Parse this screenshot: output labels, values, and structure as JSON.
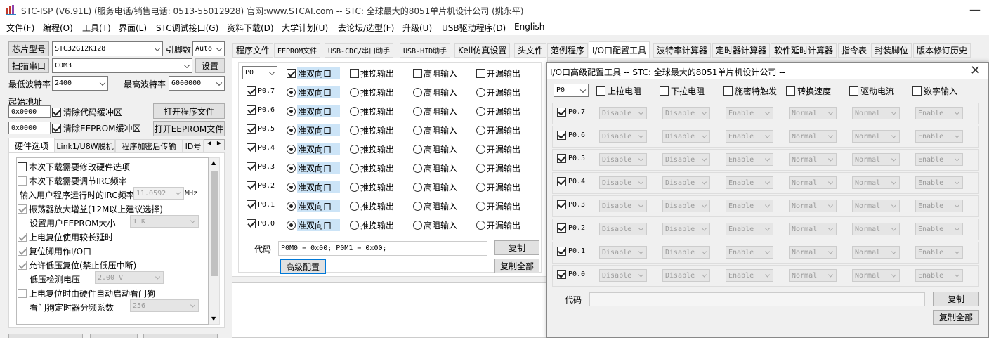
{
  "window": {
    "title": "STC-ISP (V6.91L) (服务电话/销售电话: 0513-55012928) 官网:www.STCAI.com  -- STC: 全球最大的8051单片机设计公司 (姚永平)"
  },
  "menu": [
    "文件(F)",
    "编程(O)",
    "工具(T)",
    "界面(L)",
    "STC调试接口(G)",
    "资料下载(D)",
    "大学计划(U)",
    "去论坛/选型(F)",
    "升级(U)",
    "USB驱动程序(D)",
    "English"
  ],
  "left": {
    "chip_label": "芯片型号",
    "chip_value": "STC32G12K128",
    "pins_label": "引脚数",
    "pins_value": "Auto",
    "scan_button": "扫描串口",
    "port_value": "COM3",
    "settings_button": "设置",
    "min_baud_label": "最低波特率",
    "min_baud_value": "2400",
    "max_baud_label": "最高波特率",
    "max_baud_value": "6000000",
    "start_addr_label": "起始地址",
    "addr1": "0x0000",
    "clear_code": "清除代码缓冲区",
    "open_prog": "打开程序文件",
    "addr2": "0x0000",
    "clear_eeprom": "清除EEPROM缓冲区",
    "open_eeprom": "打开EEPROM文件",
    "tabs": [
      "硬件选项",
      "Link1/U8W脱机",
      "程序加密后传输",
      "ID号"
    ],
    "options": [
      {
        "text": "本次下载需要修改硬件选项",
        "checked": false,
        "enabled": true
      },
      {
        "text": "本次下载需要调节IRC频率",
        "checked": false,
        "enabled": false
      },
      {
        "text": "输入用户程序运行时的IRC频率",
        "value": "11.0592",
        "unit": "MHz"
      },
      {
        "text": "振荡器放大增益(12M以上建议选择)",
        "checked": true,
        "enabled": false
      },
      {
        "text": "设置用户EEPROM大小",
        "value": "1   K"
      },
      {
        "text": "上电复位使用较长延时",
        "checked": true,
        "enabled": false
      },
      {
        "text": "复位脚用作I/O口",
        "checked": true,
        "enabled": false
      },
      {
        "text": "允许低压复位(禁止低压中断)",
        "checked": true,
        "enabled": false
      },
      {
        "text": "低压检测电压",
        "value": "2.00 V"
      },
      {
        "text": "上电复位时由硬件自动启动看门狗",
        "checked": false,
        "enabled": false
      },
      {
        "text": "看门狗定时器分频系数",
        "value": "256"
      }
    ]
  },
  "main_tabs": [
    "程序文件",
    "EEPROM文件",
    "USB-CDC/串口助手",
    "USB-HID助手",
    "Keil仿真设置",
    "头文件",
    "范例程序",
    "I/O口配置工具",
    "波特率计算器",
    "定时器计算器",
    "软件延时计算器",
    "指令表",
    "封装脚位",
    "版本修订历史"
  ],
  "io": {
    "port": "P0",
    "modes": [
      "准双向口",
      "推挽输出",
      "高阻输入",
      "开漏输出"
    ],
    "pins": [
      "P0.7",
      "P0.6",
      "P0.5",
      "P0.4",
      "P0.3",
      "P0.2",
      "P0.1",
      "P0.0"
    ],
    "code_label": "代码",
    "code_value": "P0M0 = 0x00; P0M1 = 0x00;",
    "copy": "复制",
    "copy_all": "复制全部",
    "advanced": "高级配置"
  },
  "adv": {
    "title": "I/O口高级配置工具 -- STC: 全球最大的8051单片机设计公司 --",
    "port": "P0",
    "headers": [
      "上拉电阻",
      "下拉电阻",
      "施密特触发",
      "转换速度",
      "驱动电流",
      "数字输入"
    ],
    "cells": [
      "Disable",
      "Disable",
      "Enable",
      "Normal",
      "Normal",
      "Enable"
    ],
    "pins": [
      "P0.7",
      "P0.6",
      "P0.5",
      "P0.4",
      "P0.3",
      "P0.2",
      "P0.1",
      "P0.0"
    ],
    "code_label": "代码",
    "copy": "复制",
    "copy_all": "复制全部"
  },
  "colors": {
    "accent": "#cce4f7",
    "bg": "#f0f0f0"
  }
}
